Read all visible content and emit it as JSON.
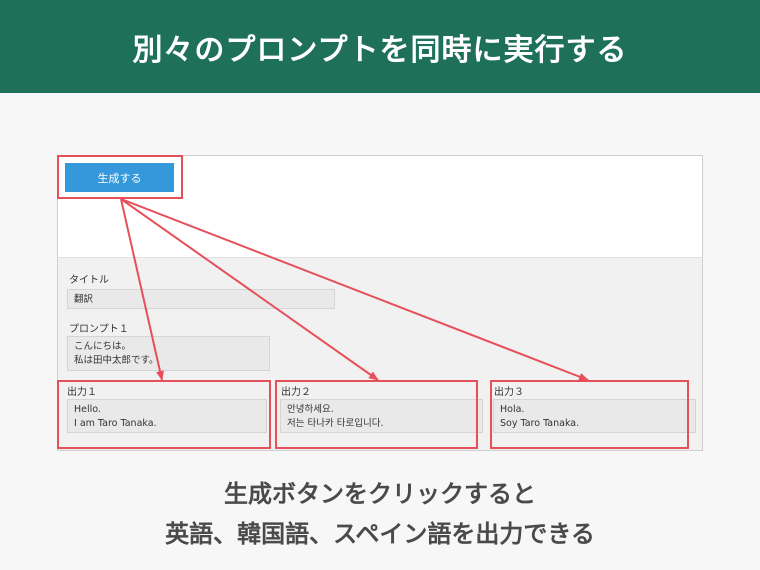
{
  "banner": {
    "title": "別々のプロンプトを同時に実行する"
  },
  "app": {
    "generate_button": "生成する",
    "title_label": "タイトル",
    "title_value": "翻訳",
    "prompt_label": "プロンプト１",
    "prompt_lines": [
      "こんにちは。",
      "私は田中太郎です。"
    ],
    "outputs": [
      {
        "label": "出力１",
        "lines": [
          "Hello.",
          "I am Taro Tanaka."
        ]
      },
      {
        "label": "出力２",
        "lines": [
          "안녕하세요.",
          "저는 타나카 타로입니다."
        ]
      },
      {
        "label": "出力３",
        "lines": [
          "Hola.",
          "Soy Taro Tanaka."
        ]
      }
    ]
  },
  "caption": {
    "line1": "生成ボタンをクリックすると",
    "line2": "英語、韓国語、スペイン語を出力できる"
  },
  "colors": {
    "banner": "#1e7158",
    "highlight": "#e6505a",
    "button": "#3498db"
  }
}
